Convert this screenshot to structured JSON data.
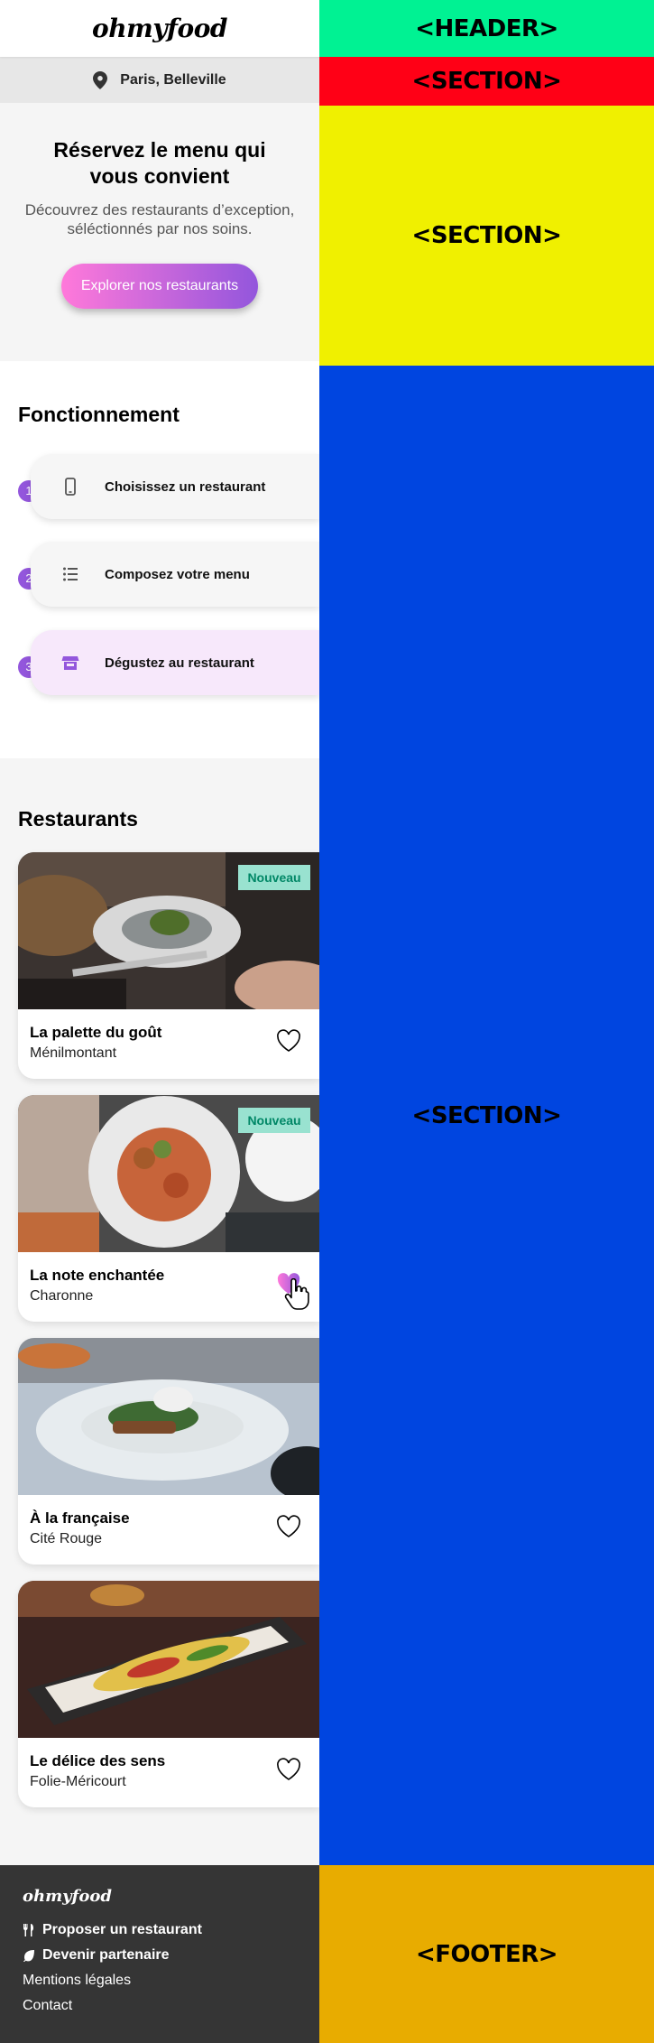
{
  "header": {
    "logo": "ohmyfood"
  },
  "location": {
    "text": "Paris, Belleville"
  },
  "hero": {
    "title": "Réservez le menu qui vous convient",
    "subtitle": "Découvrez des restaurants d’exception, séléctionnés par nos soins.",
    "button_label": "Explorer nos restaurants"
  },
  "steps": {
    "title": "Fonctionnement",
    "items": [
      {
        "num": "1",
        "label": "Choisissez un restaurant",
        "icon": "phone-icon"
      },
      {
        "num": "2",
        "label": "Composez votre menu",
        "icon": "list-icon"
      },
      {
        "num": "3",
        "label": "Dégustez au restaurant",
        "icon": "store-icon"
      }
    ]
  },
  "restaurants": {
    "title": "Restaurants",
    "items": [
      {
        "name": "La palette du goût",
        "location": "Ménilmontant",
        "badge": "Nouveau",
        "liked": false
      },
      {
        "name": "La note enchantée",
        "location": "Charonne",
        "badge": "Nouveau",
        "liked": true
      },
      {
        "name": "À la française",
        "location": "Cité Rouge",
        "badge": "",
        "liked": false
      },
      {
        "name": "Le délice des sens",
        "location": "Folie-Méricourt",
        "badge": "",
        "liked": false
      }
    ]
  },
  "footer": {
    "logo": "ohmyfood",
    "links": [
      {
        "label": "Proposer un restaurant",
        "icon": "utensils-icon"
      },
      {
        "label": "Devenir partenaire",
        "icon": "leaf-icon"
      },
      {
        "label": "Mentions légales",
        "icon": ""
      },
      {
        "label": "Contact",
        "icon": ""
      }
    ]
  },
  "annotations": [
    {
      "label": "<HEADER>",
      "color": "#00f293"
    },
    {
      "label": "<SECTION>",
      "color": "#ff0016"
    },
    {
      "label": "<SECTION>",
      "color": "#f0f000"
    },
    {
      "label": "<SECTION>",
      "color": "#0045e0"
    },
    {
      "label": "<FOOTER>",
      "color": "#e8ac00"
    }
  ],
  "colors": {
    "accent": "#9356dc",
    "accent_light": "#ff79da",
    "badge_bg": "#99e2d0",
    "badge_text": "#008766",
    "footer_bg": "#353535"
  }
}
